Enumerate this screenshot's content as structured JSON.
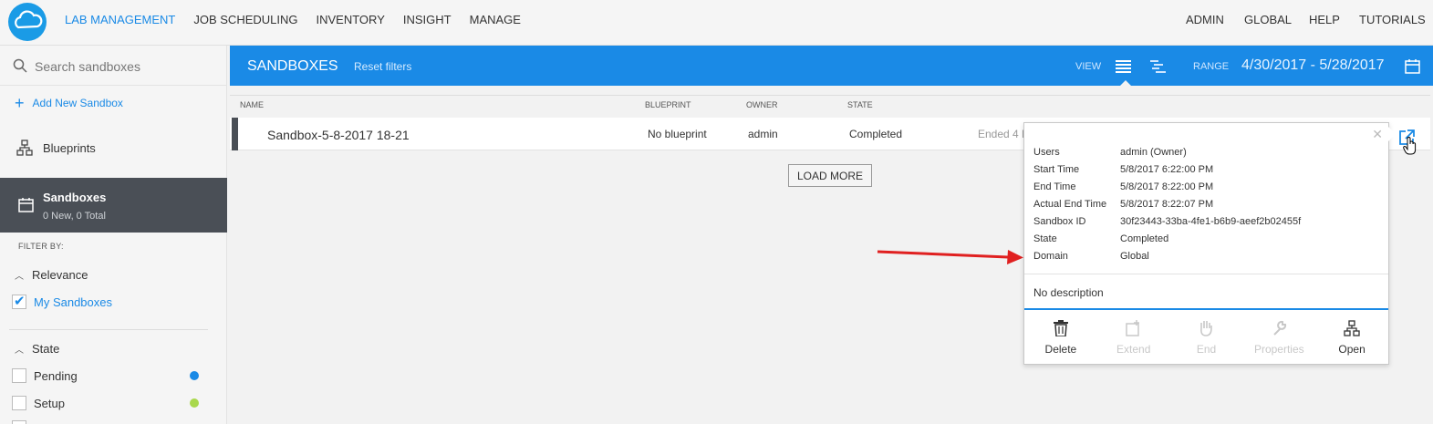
{
  "topnav": {
    "left": [
      "LAB MANAGEMENT",
      "JOB SCHEDULING",
      "INVENTORY",
      "INSIGHT",
      "MANAGE"
    ],
    "right": [
      "ADMIN",
      "GLOBAL",
      "HELP",
      "TUTORIALS"
    ],
    "active_index": 0
  },
  "sidebar": {
    "search_placeholder": "Search sandboxes",
    "add_new": "Add New Sandbox",
    "blueprints": "Blueprints",
    "sandboxes": {
      "title": "Sandboxes",
      "subtitle": "0 New,   0 Total"
    },
    "filter_by": "FILTER BY:",
    "relevance": {
      "title": "Relevance",
      "items": [
        {
          "label": "My Sandboxes",
          "checked": true
        }
      ]
    },
    "state": {
      "title": "State",
      "items": [
        {
          "label": "Pending",
          "checked": false,
          "color": "#1a8ae6"
        },
        {
          "label": "Setup",
          "checked": false,
          "color": "#a9d84c"
        }
      ]
    }
  },
  "header": {
    "title": "SANDBOXES",
    "reset": "Reset filters",
    "view_label": "VIEW",
    "range_label": "RANGE",
    "range_value": "4/30/2017 - 5/28/2017"
  },
  "table": {
    "columns": [
      "NAME",
      "BLUEPRINT",
      "OWNER",
      "STATE"
    ],
    "rows": [
      {
        "name": "Sandbox-5-8-2017 18-21",
        "blueprint": "No blueprint",
        "owner": "admin",
        "state": "Completed",
        "ended": "Ended 4 D"
      }
    ],
    "load_more": "LOAD MORE"
  },
  "popup": {
    "close": "✕",
    "details": [
      {
        "key": "Users",
        "value": "admin (Owner)"
      },
      {
        "key": "Start Time",
        "value": "5/8/2017 6:22:00 PM"
      },
      {
        "key": "End Time",
        "value": "5/8/2017 8:22:00 PM"
      },
      {
        "key": "Actual End Time",
        "value": "5/8/2017 8:22:07 PM"
      },
      {
        "key": "Sandbox ID",
        "value": "30f23443-33ba-4fe1-b6b9-aeef2b02455f"
      },
      {
        "key": "State",
        "value": "Completed"
      },
      {
        "key": "Domain",
        "value": "Global"
      }
    ],
    "description": "No description",
    "actions": [
      {
        "label": "Delete",
        "icon": "trash-icon",
        "enabled": true
      },
      {
        "label": "Extend",
        "icon": "extend-icon",
        "enabled": false
      },
      {
        "label": "End",
        "icon": "hand-stop-icon",
        "enabled": false
      },
      {
        "label": "Properties",
        "icon": "wrench-icon",
        "enabled": false
      },
      {
        "label": "Open",
        "icon": "blueprint-open-icon",
        "enabled": true
      }
    ]
  },
  "colors": {
    "accent": "#1a8ae6",
    "dark": "#4a4f56",
    "arrow": "#e02020"
  }
}
